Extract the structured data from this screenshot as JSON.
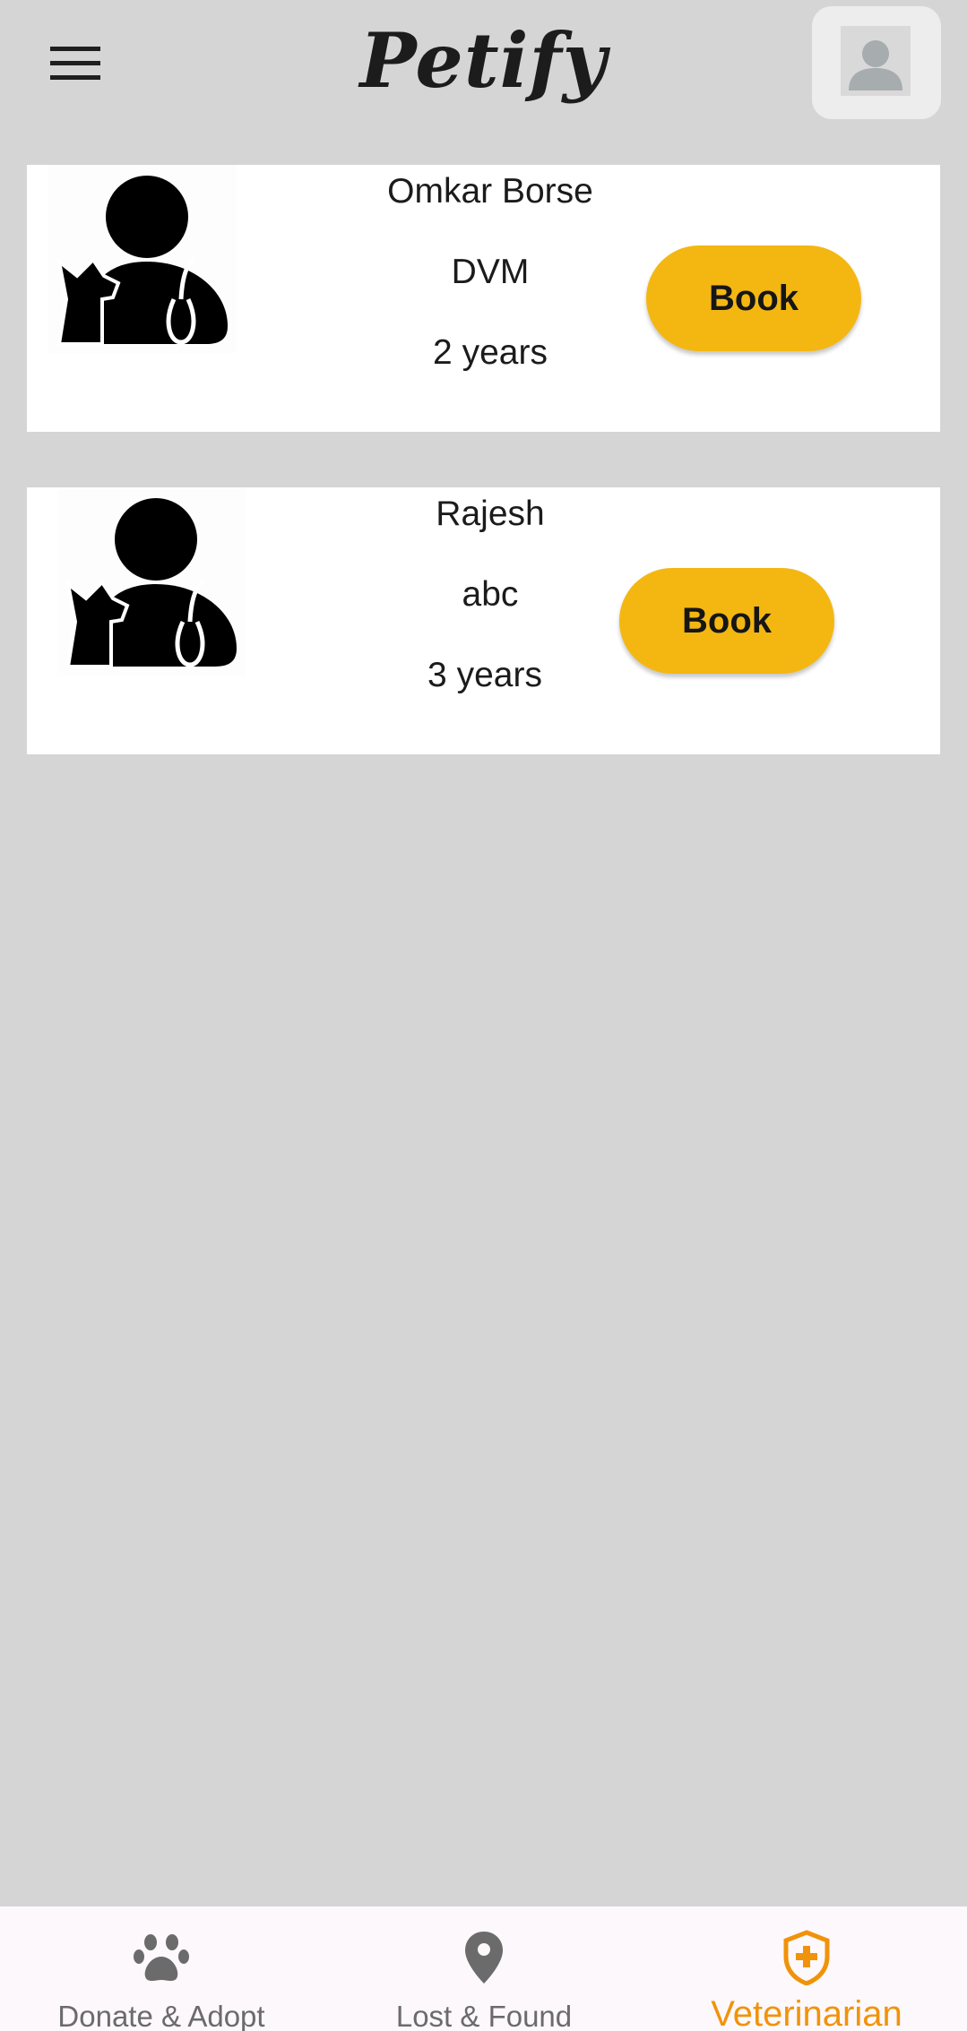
{
  "header": {
    "title": "Petify",
    "menu_icon": "hamburger-menu-icon",
    "profile_icon": "person-avatar-icon"
  },
  "vets": [
    {
      "name": "Omkar Borse",
      "degree": "DVM",
      "experience": "2 years",
      "book_label": "Book",
      "image_icon": "veterinarian-icon"
    },
    {
      "name": "Rajesh",
      "degree": "abc",
      "experience": "3 years",
      "book_label": "Book",
      "image_icon": "veterinarian-icon"
    }
  ],
  "bottom_nav": {
    "items": [
      {
        "label": "Donate & Adopt",
        "icon": "paw-icon",
        "active": false
      },
      {
        "label": "Lost & Found",
        "icon": "location-pin-icon",
        "active": false
      },
      {
        "label": "Veterinarian",
        "icon": "shield-plus-icon",
        "active": true
      }
    ]
  },
  "colors": {
    "background": "#d5d5d5",
    "book_button": "#f4b712",
    "active_tab": "#f0930a",
    "inactive_tab": "#6b6b6b"
  }
}
